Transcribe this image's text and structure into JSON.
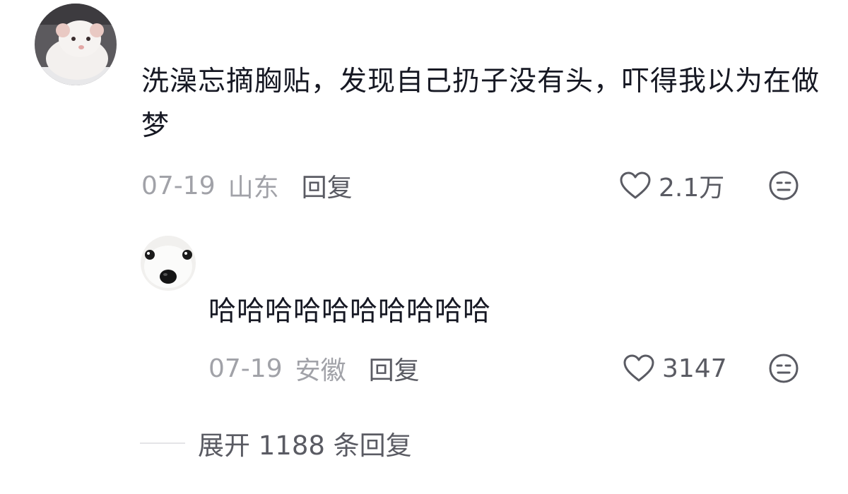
{
  "comment": {
    "avatar_icon": "rat-avatar",
    "text": "洗澡忘摘胸贴，发现自己扔子没有头，吓得我以为在做梦",
    "date": "07-19",
    "location": "山东",
    "reply_label": "回复",
    "likes": "2.1万",
    "like_icon": "heart-icon",
    "dislike_icon": "meh-face-icon"
  },
  "reply": {
    "avatar_icon": "dog-avatar",
    "text": "哈哈哈哈哈哈哈哈哈哈",
    "date": "07-19",
    "location": "安徽",
    "reply_label": "回复",
    "likes": "3147",
    "like_icon": "heart-icon",
    "dislike_icon": "meh-face-icon"
  },
  "expand": {
    "label": "展开 1188 条回复"
  },
  "colors": {
    "text_primary": "#161823",
    "text_secondary": "#a1a2a8",
    "text_action": "#5a5b63",
    "divider": "#e4e4e7"
  }
}
